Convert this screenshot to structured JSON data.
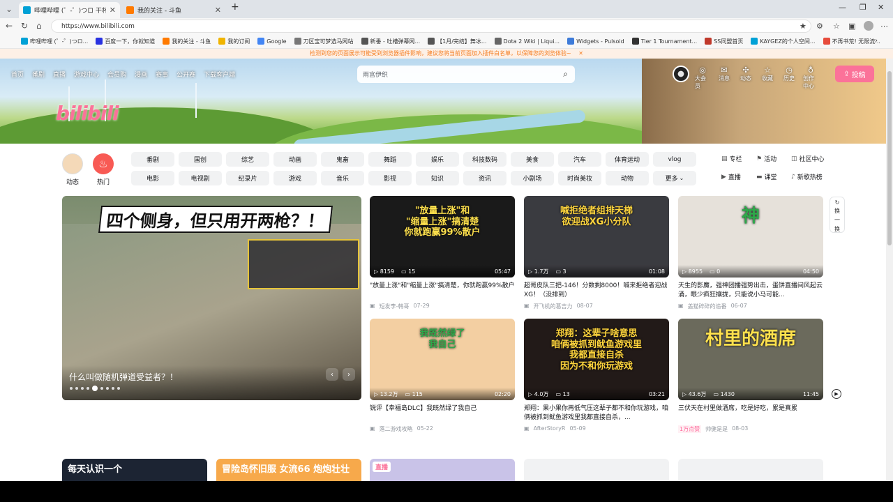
{
  "tabs": [
    {
      "label": "哔哩哔哩 (゜-゜)つロ 干杯~-bilibili",
      "active": true,
      "fav_color": "#00a1d6"
    },
    {
      "label": "我的关注 - 斗鱼",
      "active": false,
      "fav_color": "#ff7a00"
    }
  ],
  "url": "https://www.bilibili.com",
  "bookmarks": [
    {
      "label": "哔哩哔哩 (゜-゜)つロ...",
      "color": "#00a1d6"
    },
    {
      "label": "百度一下，你就知道",
      "color": "#2932e1"
    },
    {
      "label": "我的关注 - 斗鱼",
      "color": "#ff7a00"
    },
    {
      "label": "我的订阅",
      "color": "#f0b400"
    },
    {
      "label": "Google",
      "color": "#4285f4"
    },
    {
      "label": "刀区宝可梦选马网站",
      "color": "#777777"
    },
    {
      "label": "新番 - 吐槽弹幕网...",
      "color": "#555555"
    },
    {
      "label": "【1月/完结】舞冰...",
      "color": "#555555"
    },
    {
      "label": "Dota 2 Wiki | Liqui...",
      "color": "#666666"
    },
    {
      "label": "Widgets - Pulsoid",
      "color": "#3d7bd9"
    },
    {
      "label": "Tier 1 Tournament...",
      "color": "#333333"
    },
    {
      "label": "SS同盟首页",
      "color": "#c0392b"
    },
    {
      "label": "KAYGEZ的个人空间...",
      "color": "#00a1d6"
    },
    {
      "label": "不再书荒! 无限流...",
      "color": "#e74c3c"
    }
  ],
  "notice": "检测到您的页面展示可能受到浏览器插件影响，建议您将当前页面加入插件白名单，以保障您的浏览体验~",
  "topnav": [
    "首页",
    "番剧",
    "直播",
    "游戏中心",
    "会员购",
    "漫画",
    "赛事",
    "公开赛",
    "下载客户端"
  ],
  "search_placeholder": "雨宫伊织",
  "right_icons": [
    {
      "label": "大会员",
      "glyph": "◎"
    },
    {
      "label": "消息",
      "glyph": "✉"
    },
    {
      "label": "动态",
      "glyph": "✣"
    },
    {
      "label": "收藏",
      "glyph": "☆"
    },
    {
      "label": "历史",
      "glyph": "◷"
    },
    {
      "label": "创作中心",
      "glyph": "♁"
    }
  ],
  "upload_label": "投稿",
  "logo_text": "bilibili",
  "left_entries": [
    {
      "label": "动态",
      "color": "#f4d9b8"
    },
    {
      "label": "热门",
      "color": "#f85a54"
    }
  ],
  "channels": [
    "番剧",
    "国创",
    "综艺",
    "动画",
    "鬼畜",
    "舞蹈",
    "娱乐",
    "科技数码",
    "美食",
    "汽车",
    "体育运动",
    "vlog",
    "电影",
    "电视剧",
    "纪录片",
    "游戏",
    "音乐",
    "影视",
    "知识",
    "资讯",
    "小剧场",
    "时尚美妆",
    "动物",
    "更多"
  ],
  "side_links": [
    {
      "label": "专栏",
      "glyph": "▤"
    },
    {
      "label": "活动",
      "glyph": "⚑"
    },
    {
      "label": "社区中心",
      "glyph": "◫"
    },
    {
      "label": "直播",
      "glyph": "▶"
    },
    {
      "label": "课堂",
      "glyph": "▬"
    },
    {
      "label": "新歌热榜",
      "glyph": "♪"
    }
  ],
  "carousel": {
    "headline": "四个侧身，但只用开两枪？！",
    "title": "什么叫做随机弹道受益者？！",
    "dots": 9,
    "active_dot": 4
  },
  "refresh_label": [
    "换",
    "一",
    "换"
  ],
  "cards": [
    {
      "thumb_text": "\"放量上涨\"和\n\"缩量上涨\"搞清楚\n你就跑赢99%散户",
      "bg": "#1a1a1a",
      "fg": "#ffe14d",
      "views": "8159",
      "danmaku": "15",
      "duration": "05:47",
      "title": "\"放量上涨\"和\"缩量上涨\"搞清楚，你就跑赢99%散户",
      "author": "短发李-韩哥",
      "date": "07-29"
    },
    {
      "thumb_text": "喊拒绝者组排天梯\n欲迎战XG小分队",
      "bg": "#3a3b40",
      "fg": "#ffd53d",
      "views": "1.7万",
      "danmaku": "3",
      "duration": "01:08",
      "title": "超哥皮队三把-146！分数剩8000！喊来拒绝者迎战XG！（没排到）",
      "author": "开飞机的葛吉力",
      "date": "08-07"
    },
    {
      "thumb_text": "神",
      "bg": "#e6e1da",
      "fg": "#2ea84a",
      "views": "8955",
      "danmaku": "0",
      "duration": "04:50",
      "title": "天生的影魔，强神团播强势出击，蛋饼直播间风起云涌，眼少疯狂攘拢，只能说小马可能...",
      "author": "盖猫碎碎的追番",
      "date": "06-07"
    },
    {
      "thumb_text": "我既然绿了\n我自己",
      "bg": "#f3cfa2",
      "fg": "#2ea84a",
      "views": "13.2万",
      "danmaku": "115",
      "duration": "02:20",
      "title": "锐评【幸福岛DLC】我既然绿了我自己",
      "author": "落二游戏攻略",
      "date": "05-22"
    },
    {
      "thumb_text": "郑翔：这辈子啥意思\n咱俩被抓到鱿鱼游戏里\n我都直接自杀\n因为不和你玩游戏",
      "bg": "#221a18",
      "fg": "#ffd53d",
      "views": "4.0万",
      "danmaku": "13",
      "duration": "03:21",
      "title": "郑翔：果小果你再低气压这辈子都不和你玩游戏，咱俩被抓到鱿鱼游戏里我都直接自杀，...",
      "author": "AfterStoryR",
      "date": "05-09"
    },
    {
      "thumb_text": "村里的酒席",
      "bg": "#6b6a5c",
      "fg": "#ffe14d",
      "views": "43.6万",
      "danmaku": "1430",
      "duration": "11:45",
      "title": "三伏天在村里做酒席，吃是好吃，累是真累",
      "author": "帅健是是",
      "date": "08-03",
      "badge": "1万点赞"
    }
  ],
  "bottom_row": [
    {
      "text": "每天认识一个",
      "bg": "#1c2433",
      "fg": "#ffffff"
    },
    {
      "text": "冒险岛怀旧服 女流66 炮炮壮壮",
      "bg": "#f7a94b",
      "fg": "#ffffff"
    },
    {
      "text": "直播",
      "bg": "#c9c3e8",
      "fg": "#fb7299"
    },
    {
      "text": "",
      "bg": "#f1f2f3",
      "fg": "#000000"
    },
    {
      "text": "",
      "bg": "#f1f2f3",
      "fg": "#000000"
    }
  ],
  "colors": {
    "brand_pink": "#fb7299",
    "bili_blue": "#00a1d6",
    "notice_orange": "#f57c1f"
  }
}
